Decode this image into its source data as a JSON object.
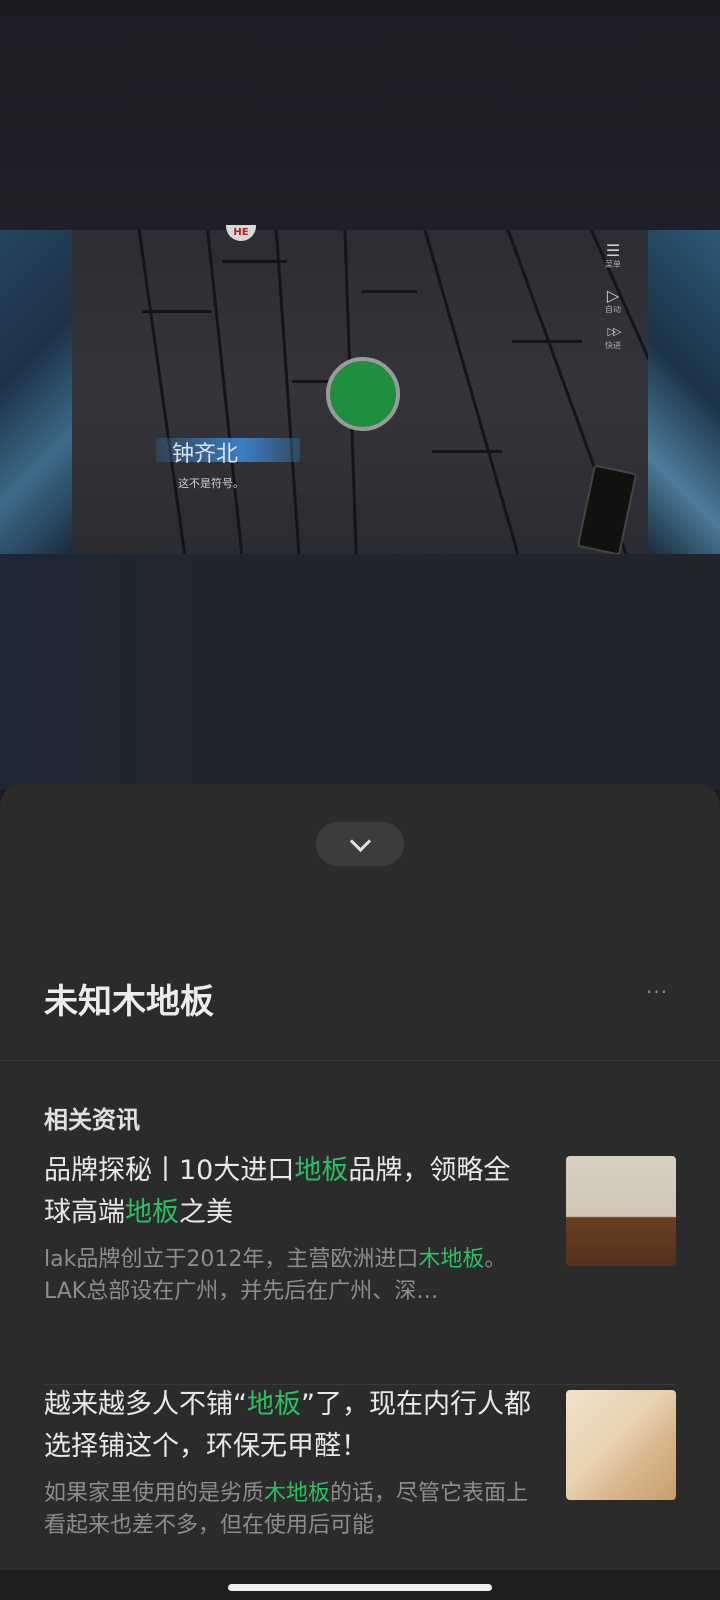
{
  "game": {
    "badge": "HE",
    "controls": [
      {
        "glyph": "☰",
        "label": "菜单"
      },
      {
        "glyph": "▷",
        "label": "自动"
      },
      {
        "glyph": "▷▷",
        "label": "快进"
      }
    ],
    "character_name": "钟齐北",
    "dialogue": "这不是符号。"
  },
  "sheet": {
    "title": "未知木地板",
    "more_label": "···",
    "section_label": "相关资讯"
  },
  "articles": [
    {
      "title_parts": [
        "品牌探秘丨10大进口",
        "地板",
        "品牌，领略全球高端",
        "地板",
        "之美"
      ],
      "desc_parts": [
        "lak品牌创立于2012年，主营欧洲进口",
        "木地板",
        "。LAK总部设在广州，并先后在广州、深…"
      ]
    },
    {
      "title_parts": [
        "越来越多人不铺“",
        "地板",
        "”了，现在内行人都选择铺这个，环保无甲醛！"
      ],
      "desc_parts": [
        "如果家里使用的是劣质",
        "木地板",
        "的话，尽管它表面上看起来也差不多，但在使用后可能"
      ]
    }
  ]
}
